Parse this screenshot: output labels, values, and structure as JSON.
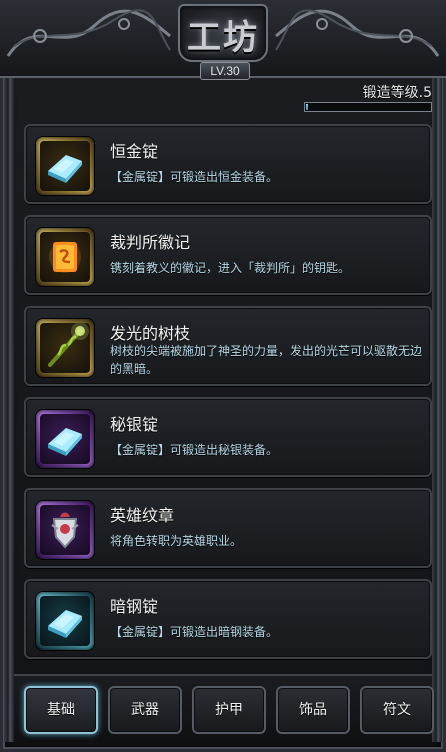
{
  "header": {
    "title": "工坊",
    "level": "LV.30"
  },
  "forge": {
    "label": "锻造等级.5",
    "progress": 0.02
  },
  "items": [
    {
      "name": "恒金锭",
      "desc": "【金属锭】可锻造出恒金装备。",
      "icon": "blue-ingot-icon",
      "frame": "gold"
    },
    {
      "name": "裁判所徽记",
      "desc": "镌刻着教义的徽记，进入「裁判所」的钥匙。",
      "icon": "emblem-icon",
      "frame": "gold"
    },
    {
      "name": "发光的树枝",
      "desc": "树枝的尖端被施加了神圣的力量，发出的光芒可以驱散无边的黑暗。",
      "icon": "glowing-branch-icon",
      "frame": "gold"
    },
    {
      "name": "秘银锭",
      "desc": "【金属锭】可锻造出秘银装备。",
      "icon": "blue-ingot-icon",
      "frame": "purple"
    },
    {
      "name": "英雄纹章",
      "desc": "将角色转职为英雄职业。",
      "icon": "hero-crest-icon",
      "frame": "purple"
    },
    {
      "name": "暗钢锭",
      "desc": "【金属锭】可锻造出暗钢装备。",
      "icon": "blue-ingot-icon",
      "frame": "teal"
    }
  ],
  "tabs": [
    {
      "label": "基础",
      "active": true
    },
    {
      "label": "武器",
      "active": false
    },
    {
      "label": "护甲",
      "active": false
    },
    {
      "label": "饰品",
      "active": false
    },
    {
      "label": "符文",
      "active": false
    }
  ],
  "colors": {
    "accent": "#8fc3d6",
    "desc_text": "#b6d8e6",
    "gold_frame": "#d9b95a",
    "purple_frame": "#a970e0",
    "teal_frame": "#5ab8c9"
  }
}
